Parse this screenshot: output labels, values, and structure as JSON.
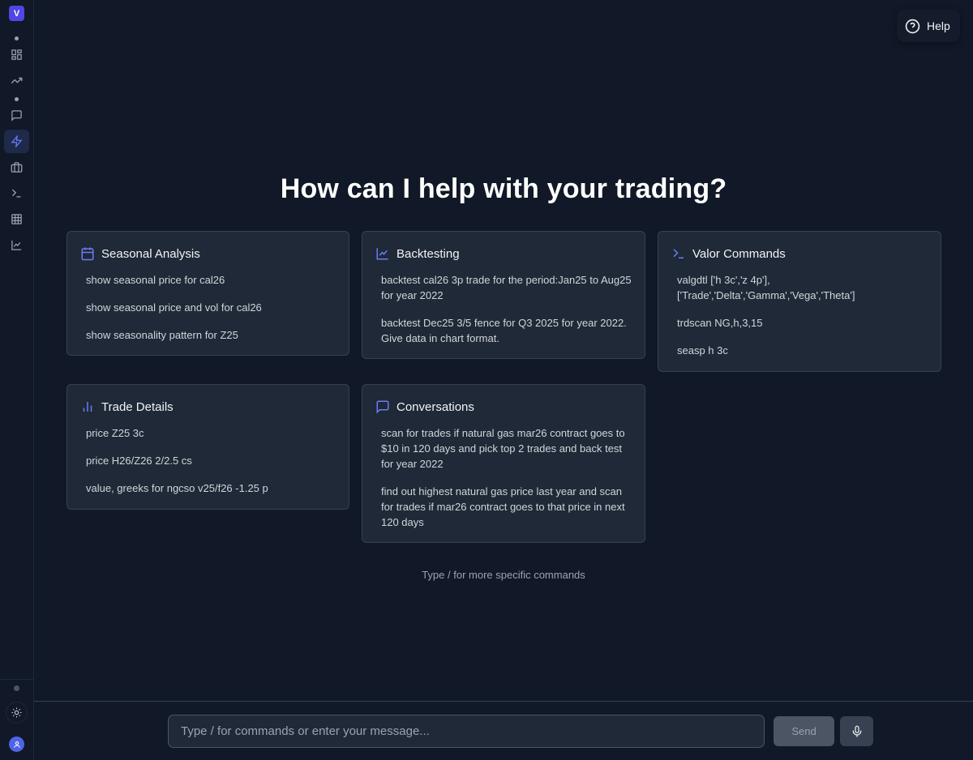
{
  "app": {
    "logo_letter": "V"
  },
  "sidebar": {
    "items": [
      {
        "icon": "dashboard-icon"
      },
      {
        "icon": "trending-up-icon"
      },
      {
        "icon": "chat-icon"
      },
      {
        "icon": "lightning-icon",
        "active": true
      },
      {
        "icon": "briefcase-icon"
      },
      {
        "icon": "terminal-icon"
      },
      {
        "icon": "table-icon"
      },
      {
        "icon": "line-chart-icon"
      }
    ]
  },
  "header": {
    "help_label": "Help"
  },
  "main": {
    "headline": "How can I help with your trading?",
    "cards": [
      {
        "title": "Seasonal Analysis",
        "icon": "calendar-icon",
        "items": [
          "show seasonal price for cal26",
          "show seasonal price and vol for cal26",
          "show seasonality pattern for Z25"
        ]
      },
      {
        "title": "Backtesting",
        "icon": "line-chart-icon",
        "items": [
          "backtest cal26 3p trade for the period:Jan25 to Aug25 for year 2022",
          "backtest Dec25 3/5 fence for Q3 2025 for year 2022. Give data in chart format."
        ]
      },
      {
        "title": "Valor Commands",
        "icon": "terminal-icon",
        "items": [
          "valgdtl ['h 3c','z 4p'], ['Trade','Delta','Gamma','Vega','Theta']",
          "trdscan NG,h,3,15",
          "seasp h 3c"
        ]
      },
      {
        "title": "Trade Details",
        "icon": "bar-chart-icon",
        "items": [
          "price Z25 3c",
          "price H26/Z26 2/2.5 cs",
          "value, greeks for ngcso v25/f26 -1.25 p"
        ]
      },
      {
        "title": "Conversations",
        "icon": "chat-icon",
        "items": [
          "scan for trades if natural gas mar26 contract goes to $10 in 120 days and pick top 2 trades and back test for year 2022",
          "find out highest natural gas price last year and scan for trades if mar26 contract goes to that price in next 120 days"
        ]
      }
    ],
    "hint": "Type / for more specific commands"
  },
  "composer": {
    "placeholder": "Type / for commands or enter your message...",
    "value": "",
    "send_label": "Send"
  },
  "colors": {
    "accent": "#6b7cf6",
    "background": "#111827",
    "card": "#1f2937"
  }
}
